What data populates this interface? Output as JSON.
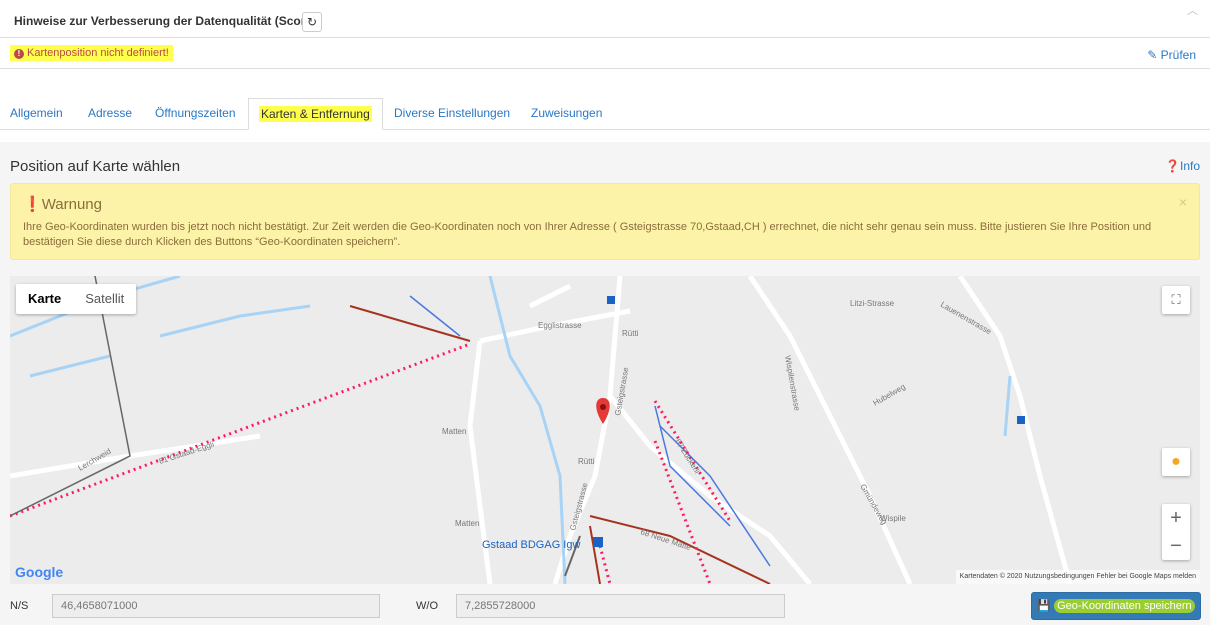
{
  "score": {
    "title": "Hinweise zur Verbesserung der Datenqualität (Score)",
    "refresh_icon": "refresh-icon",
    "message": "Kartenposition nicht definiert!",
    "message_icon": "exclamation-circle-icon",
    "check_label": "Prüfen",
    "check_icon": "pencil-icon"
  },
  "tabs": [
    {
      "label": "Allgemein"
    },
    {
      "label": "Adresse"
    },
    {
      "label": "Öffnungszeiten"
    },
    {
      "label": "Karten & Entfernung"
    },
    {
      "label": "Diverse Einstellungen"
    },
    {
      "label": "Zuweisungen"
    }
  ],
  "active_tab": "Karten & Entfernung",
  "panel": {
    "title": "Position auf Karte wählen",
    "info_label": "Info",
    "info_icon": "question-circle-icon"
  },
  "warning": {
    "title": "Warnung",
    "close": "×",
    "text": "Ihre Geo-Koordinaten wurden bis jetzt noch nicht bestätigt. Zur Zeit werden die Geo-Koordinaten noch von Ihrer Adresse ( Gsteigstrasse 70,Gstaad,CH ) errechnet, die nicht sehr genau sein muss. Bitte justieren Sie Ihre Position und bestätigen Sie diese durch Klicken des Buttons “Geo-Koordinaten speichern”."
  },
  "map": {
    "type_map": "Karte",
    "type_satellite": "Satellit",
    "fullscreen_glyph": "⛶",
    "zoom_in": "+",
    "zoom_out": "−",
    "logo": "Google",
    "attribution": "Kartendaten © 2020   Nutzungsbedingungen   Fehler bei Google Maps melden",
    "labels": {
      "egglistrasse": "Egglistrasse",
      "rutti": "Rütti",
      "rutti2": "Rütti",
      "gsteigstrasse": "Gsteigstrasse",
      "gsteigstrasse2": "Gsteigstrasse",
      "matten": "Matten",
      "matten2": "Matten",
      "lerchweid": "Lerchweid",
      "gstaad_eggli": "81 Gstaad-Eggli",
      "zuckerli": "67 Zückerli",
      "neue_matte": "68 Neue Matte",
      "station": "Gstaad BDGAG Igw",
      "litzi": "Litzi-Strasse",
      "lauenen": "Lauenenstrasse",
      "wispile": "Wispile",
      "wispilenstrasse": "Wispilenstrasse",
      "hubelweg": "Hubelweg",
      "gmundenweg": "Gmündeweg"
    }
  },
  "coordinates": {
    "ns_label": "N/S",
    "ns_value": "46,4658071000",
    "wo_label": "W/O",
    "wo_value": "7,2855728000",
    "save_label": "Geo-Koordinaten speichern",
    "save_icon": "floppy-disk-icon"
  },
  "colors": {
    "link": "#2a78c5",
    "highlight": "#ffff4d",
    "warning_bg": "#fdf3a8",
    "primary": "#337ab7",
    "marker": "#e53935",
    "piste_red": "#ff1a5e",
    "lift_brown": "#a5341f",
    "river_blue": "#a8d3f5"
  }
}
